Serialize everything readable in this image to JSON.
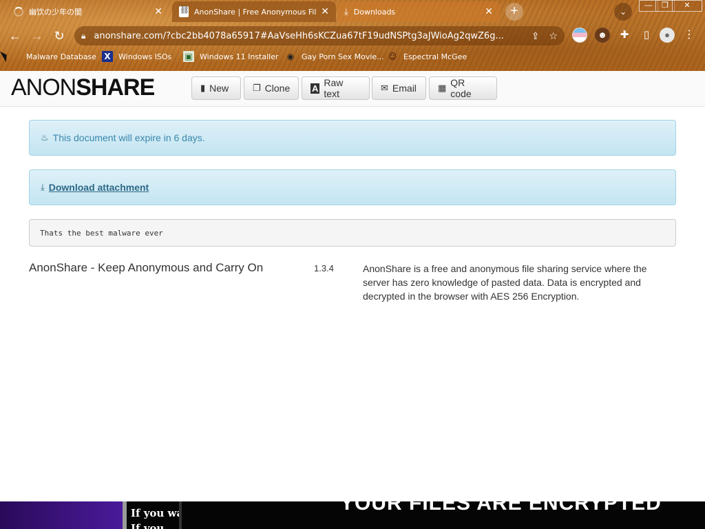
{
  "tabs": [
    {
      "title": "幽饮の少年の闇",
      "icon": "loading-spinner-icon"
    },
    {
      "title": "AnonShare | Free Anonymous File Sharing",
      "icon": "anonshare-favicon-icon"
    },
    {
      "title": "Downloads",
      "icon": "download-icon"
    }
  ],
  "toolbar": {
    "url": "anonshare.com/?cbc2bb4078a65917#AaVseHh6sKCZua67tF19udNSPtg3aJWioAg2qwZ6g..."
  },
  "bookmarks": [
    {
      "label": "Malware Database"
    },
    {
      "label": "Windows ISOs"
    },
    {
      "label": "Windows 11 Installer"
    },
    {
      "label": "Gay Porn Sex Movie..."
    },
    {
      "label": "Espectral McGee"
    }
  ],
  "site": {
    "brand_anon": "ANON",
    "brand_share": "SHARE",
    "nav": {
      "new": "New",
      "clone": "Clone",
      "raw": "Raw text",
      "email": "Email",
      "qr": "QR code"
    }
  },
  "document": {
    "expire_notice": "This document will expire in 6 days.",
    "download_label": "Download attachment",
    "content": "Thats the best malware ever"
  },
  "footer": {
    "title": "AnonShare - Keep Anonymous and Carry On",
    "version": "1.3.4",
    "description": "AnonShare is a free and anonymous file sharing service where the server has zero knowledge of pasted data. Data is encrypted and decrypted in the browser with AES 256 Encryption."
  },
  "background_window": {
    "line1": "If you wa",
    "line2": "If you",
    "banner": "YOUR FILES ARE ENCRYPTED"
  },
  "colors": {
    "alert_text": "#3a87ad",
    "alert_bg": "#d9edf7",
    "theme_sand": "#c07a2e"
  }
}
